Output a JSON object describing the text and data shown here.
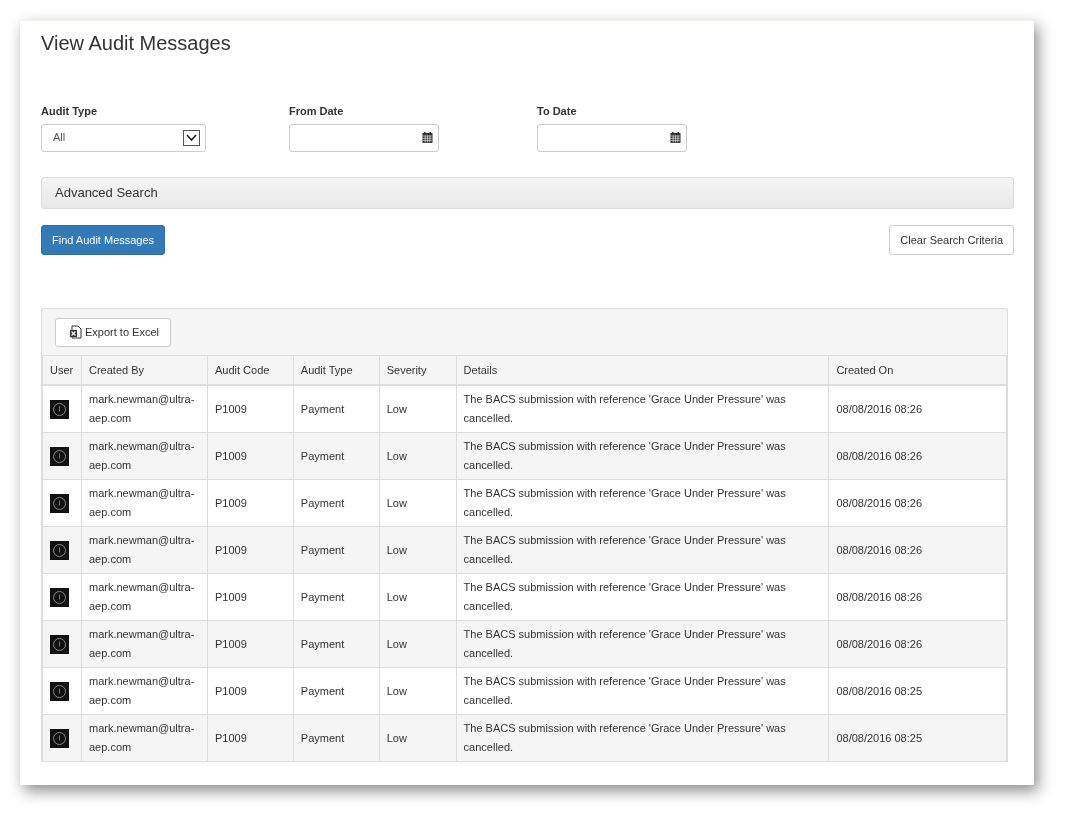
{
  "title": "View Audit Messages",
  "filters": [
    {
      "kind": "select",
      "label": "Audit Type",
      "value": "All"
    },
    {
      "kind": "date",
      "label": "From Date"
    },
    {
      "kind": "date",
      "label": "To Date"
    }
  ],
  "advanced_search": {
    "label": "Advanced Search",
    "expanded": false
  },
  "buttons": {
    "find": "Find Audit Messages",
    "clear": "Clear Search Criteria"
  },
  "export_button": "Export to Excel",
  "table": {
    "columns": [
      "User",
      "Created By",
      "Audit Code",
      "Audit Type",
      "Severity",
      "Details",
      "Created On"
    ],
    "rows": [
      {
        "created_by": "mark.newman@ultra-aep.com",
        "audit_code": "P1009",
        "audit_type": "Payment",
        "severity": "Low",
        "details": "The BACS submission with reference 'Grace Under Pressure' was cancelled.",
        "created_on": "08/08/2016 08:26"
      },
      {
        "created_by": "mark.newman@ultra-aep.com",
        "audit_code": "P1009",
        "audit_type": "Payment",
        "severity": "Low",
        "details": "The BACS submission with reference 'Grace Under Pressure' was cancelled.",
        "created_on": "08/08/2016 08:26"
      },
      {
        "created_by": "mark.newman@ultra-aep.com",
        "audit_code": "P1009",
        "audit_type": "Payment",
        "severity": "Low",
        "details": "The BACS submission with reference 'Grace Under Pressure' was cancelled.",
        "created_on": "08/08/2016 08:26"
      },
      {
        "created_by": "mark.newman@ultra-aep.com",
        "audit_code": "P1009",
        "audit_type": "Payment",
        "severity": "Low",
        "details": "The BACS submission with reference 'Grace Under Pressure' was cancelled.",
        "created_on": "08/08/2016 08:26"
      },
      {
        "created_by": "mark.newman@ultra-aep.com",
        "audit_code": "P1009",
        "audit_type": "Payment",
        "severity": "Low",
        "details": "The BACS submission with reference 'Grace Under Pressure' was cancelled.",
        "created_on": "08/08/2016 08:26"
      },
      {
        "created_by": "mark.newman@ultra-aep.com",
        "audit_code": "P1009",
        "audit_type": "Payment",
        "severity": "Low",
        "details": "The BACS submission with reference 'Grace Under Pressure' was cancelled.",
        "created_on": "08/08/2016 08:26"
      },
      {
        "created_by": "mark.newman@ultra-aep.com",
        "audit_code": "P1009",
        "audit_type": "Payment",
        "severity": "Low",
        "details": "The BACS submission with reference 'Grace Under Pressure' was cancelled.",
        "created_on": "08/08/2016 08:25"
      },
      {
        "created_by": "mark.newman@ultra-aep.com",
        "audit_code": "P1009",
        "audit_type": "Payment",
        "severity": "Low",
        "details": "The BACS submission with reference 'Grace Under Pressure' was cancelled.",
        "created_on": "08/08/2016 08:25"
      }
    ]
  }
}
